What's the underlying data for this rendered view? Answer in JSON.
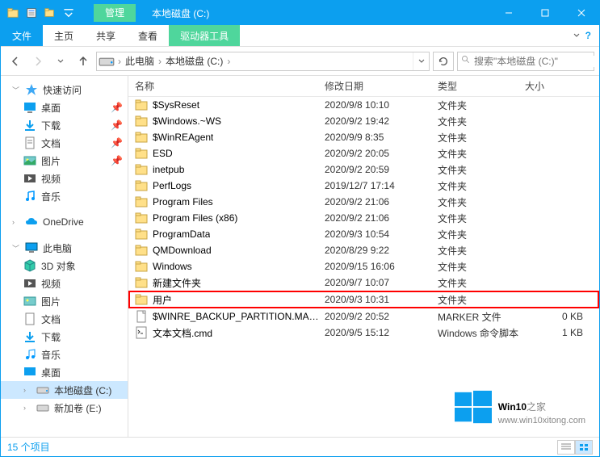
{
  "titlebar": {
    "mgmt": "管理",
    "title": "本地磁盘 (C:)"
  },
  "ribbon": {
    "file": "文件",
    "home": "主页",
    "share": "共享",
    "view": "查看",
    "drive": "驱动器工具"
  },
  "breadcrumb": {
    "pc": "此电脑",
    "drive": "本地磁盘 (C:)"
  },
  "search": {
    "placeholder": "搜索\"本地磁盘 (C:)\""
  },
  "columns": {
    "name": "名称",
    "date": "修改日期",
    "type": "类型",
    "size": "大小"
  },
  "sidebar": {
    "quick": "快速访问",
    "desktop": "桌面",
    "downloads": "下载",
    "documents": "文档",
    "pictures": "图片",
    "videos": "视频",
    "music": "音乐",
    "onedrive": "OneDrive",
    "thispc": "此电脑",
    "objects3d": "3D 对象",
    "videos2": "视频",
    "pictures2": "图片",
    "documents2": "文档",
    "downloads2": "下载",
    "music2": "音乐",
    "desktop2": "桌面",
    "localc": "本地磁盘 (C:)",
    "newvol": "新加卷 (E:)"
  },
  "files": [
    {
      "name": "$SysReset",
      "date": "2020/9/8 10:10",
      "type": "文件夹",
      "ftype": "folder"
    },
    {
      "name": "$Windows.~WS",
      "date": "2020/9/2 19:42",
      "type": "文件夹",
      "ftype": "folder"
    },
    {
      "name": "$WinREAgent",
      "date": "2020/9/9 8:35",
      "type": "文件夹",
      "ftype": "folder"
    },
    {
      "name": "ESD",
      "date": "2020/9/2 20:05",
      "type": "文件夹",
      "ftype": "folder"
    },
    {
      "name": "inetpub",
      "date": "2020/9/2 20:59",
      "type": "文件夹",
      "ftype": "folder"
    },
    {
      "name": "PerfLogs",
      "date": "2019/12/7 17:14",
      "type": "文件夹",
      "ftype": "folder"
    },
    {
      "name": "Program Files",
      "date": "2020/9/2 21:06",
      "type": "文件夹",
      "ftype": "folder"
    },
    {
      "name": "Program Files (x86)",
      "date": "2020/9/2 21:06",
      "type": "文件夹",
      "ftype": "folder"
    },
    {
      "name": "ProgramData",
      "date": "2020/9/3 10:54",
      "type": "文件夹",
      "ftype": "folder"
    },
    {
      "name": "QMDownload",
      "date": "2020/8/29 9:22",
      "type": "文件夹",
      "ftype": "folder"
    },
    {
      "name": "Windows",
      "date": "2020/9/15 16:06",
      "type": "文件夹",
      "ftype": "folder"
    },
    {
      "name": "新建文件夹",
      "date": "2020/9/7 10:07",
      "type": "文件夹",
      "ftype": "folder"
    },
    {
      "name": "用户",
      "date": "2020/9/3 10:31",
      "type": "文件夹",
      "ftype": "folder",
      "hl": true
    },
    {
      "name": "$WINRE_BACKUP_PARTITION.MARKER",
      "date": "2020/9/2 20:52",
      "type": "MARKER 文件",
      "size": "0 KB",
      "ftype": "file"
    },
    {
      "name": "文本文档.cmd",
      "date": "2020/9/5 15:12",
      "type": "Windows 命令脚本",
      "size": "1 KB",
      "ftype": "cmd"
    }
  ],
  "status": {
    "count": "15 个项目"
  },
  "watermark": {
    "brand": "Win10",
    "suffix": "之家",
    "url": "www.win10xitong.com"
  }
}
